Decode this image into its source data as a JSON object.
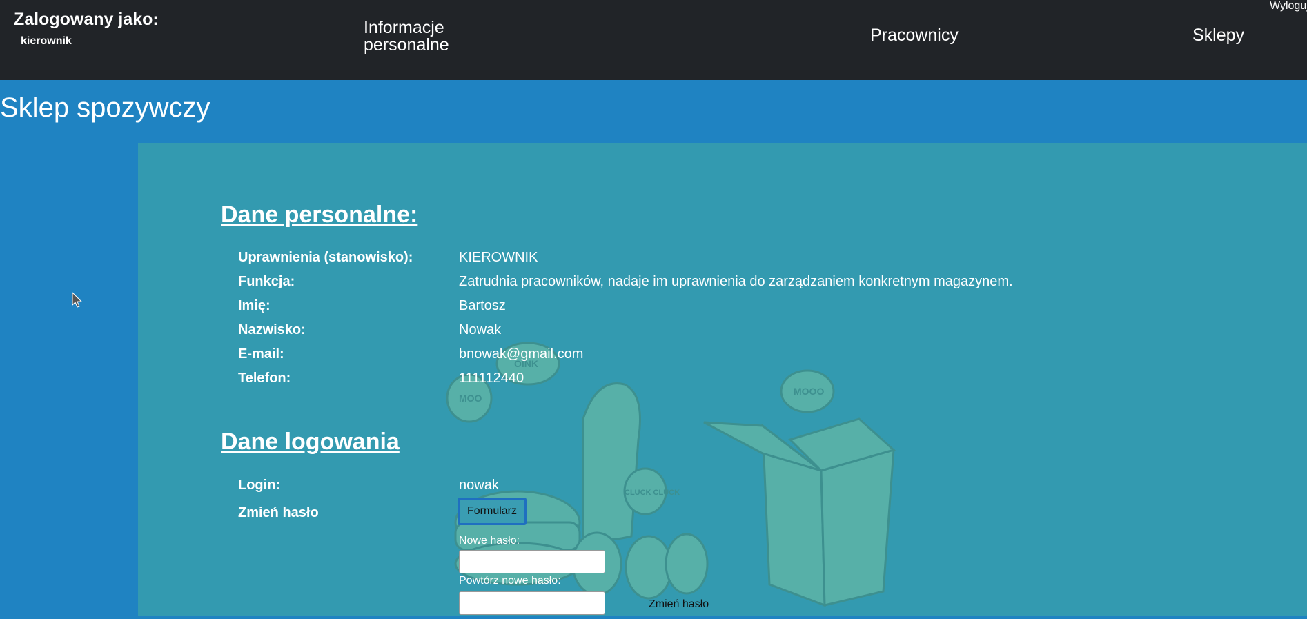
{
  "header": {
    "logged_as_label": "Zalogowany jako:",
    "username": "kierownik",
    "nav": {
      "personal_info": "Informacje personalne",
      "workers": "Pracownicy",
      "shops": "Sklepy"
    },
    "logout": "Wyloguj"
  },
  "site_title": "Sklep spozywczy",
  "personal": {
    "heading": "Dane personalne:",
    "rows": [
      {
        "label": "Uprawnienia (stanowisko):",
        "value": "KIEROWNIK"
      },
      {
        "label": "Funkcja:",
        "value": "Zatrudnia pracowników, nadaje im uprawnienia do zarządzaniem konkretnym magazynem."
      },
      {
        "label": "Imię:",
        "value": "Bartosz"
      },
      {
        "label": "Nazwisko:",
        "value": "Nowak"
      },
      {
        "label": "E-mail:",
        "value": "bnowak@gmail.com"
      },
      {
        "label": "Telefon:",
        "value": "111112440"
      }
    ]
  },
  "login": {
    "heading": "Dane logowania",
    "login_label": "Login:",
    "login_value": "nowak",
    "change_password_label": "Zmień hasło",
    "form_button": "Formularz",
    "new_password_label": "Nowe hasło:",
    "repeat_password_label": "Powtórz nowe hasło:",
    "submit_label": "Zmień hasło"
  },
  "illustration": {
    "bubbles": [
      "OINK",
      "MOO",
      "CLUCK CLUCK",
      "MOOO"
    ]
  },
  "colors": {
    "topbar": "#212428",
    "page_bg": "#1f83c2",
    "content_bg": "#339ab0",
    "illustration": "#5cb3a8"
  }
}
